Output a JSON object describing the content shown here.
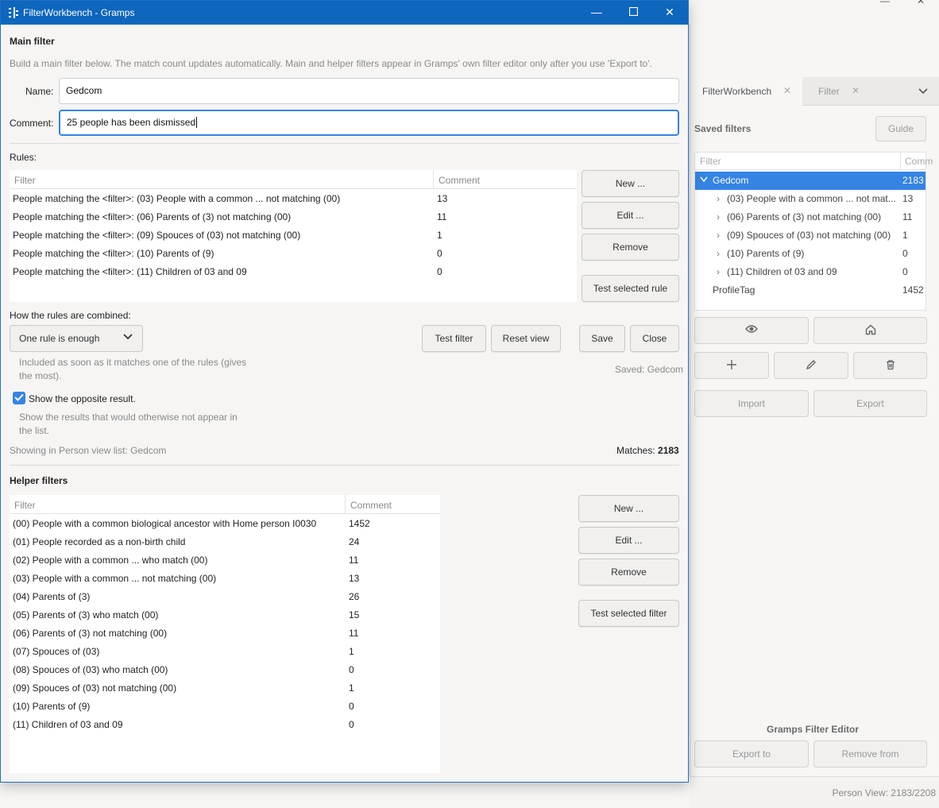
{
  "dialog": {
    "title": "FilterWorkbench - Gramps",
    "main_filter": {
      "heading": "Main filter",
      "description": "Build a main filter below. The match count updates automatically. Main and helper filters appear in Gramps' own filter editor only after you use 'Export to'.",
      "name_label": "Name:",
      "name_value": "Gedcom",
      "comment_label": "Comment:",
      "comment_value": "25 people has been dismissed",
      "rules_label": "Rules:",
      "rules_columns": [
        "Filter",
        "Comment"
      ],
      "rules": [
        {
          "filter": "People matching the <filter>: (03) People with a common ... not matching (00)",
          "comment": "13"
        },
        {
          "filter": "People matching the <filter>: (06) Parents of (3) not matching (00)",
          "comment": "11"
        },
        {
          "filter": "People matching the <filter>: (09) Spouces of (03) not matching (00)",
          "comment": "1"
        },
        {
          "filter": "People matching the <filter>: (10) Parents of (9)",
          "comment": "0"
        },
        {
          "filter": "People matching the <filter>: (11) Children of 03 and 09",
          "comment": "0"
        }
      ],
      "rule_buttons": {
        "new": "New ...",
        "edit": "Edit ...",
        "remove": "Remove",
        "test": "Test selected rule"
      },
      "combine_label": "How the rules are combined:",
      "combine_value": "One rule is enough",
      "combine_help": [
        "Included as soon as it matches one of the rules (gives",
        "the most)."
      ],
      "test_filter": "Test filter",
      "reset_view": "Reset view",
      "save": "Save",
      "close": "Close",
      "saved_status": "Saved: Gedcom",
      "opposite_label": "Show the opposite result.",
      "opposite_checked": true,
      "opposite_help": [
        "Show the results that would otherwise not appear in",
        "the list."
      ],
      "showing_text": "Showing in Person view list: Gedcom",
      "matches_label": "Matches:",
      "matches_value": "2183"
    },
    "helper_filters": {
      "heading": "Helper filters",
      "columns": [
        "Filter",
        "Comment"
      ],
      "rows": [
        {
          "filter": "(00) People with a common biological ancestor with Home person I0030",
          "comment": "1452"
        },
        {
          "filter": "(01) People recorded as a non-birth child",
          "comment": "24"
        },
        {
          "filter": "(02) People with a common ... who match (00)",
          "comment": "11"
        },
        {
          "filter": "(03) People with a common ... not matching (00)",
          "comment": "13"
        },
        {
          "filter": "(04) Parents of (3)",
          "comment": "26"
        },
        {
          "filter": "(05) Parents of (3) who match (00)",
          "comment": "15"
        },
        {
          "filter": "(06) Parents of (3) not matching (00)",
          "comment": "11"
        },
        {
          "filter": "(07) Spouces of (03)",
          "comment": "1"
        },
        {
          "filter": "(08) Spouces of (03) who match (00)",
          "comment": "0"
        },
        {
          "filter": "(09) Spouces of (03) not matching (00)",
          "comment": "1"
        },
        {
          "filter": "(10) Parents of (9)",
          "comment": "0"
        },
        {
          "filter": "(11) Children of 03 and 09",
          "comment": "0"
        }
      ],
      "buttons": {
        "new": "New ...",
        "edit": "Edit ...",
        "remove": "Remove",
        "test": "Test selected filter"
      }
    }
  },
  "sidebar": {
    "tabs": [
      {
        "label": "FilterWorkbench"
      },
      {
        "label": "Filter"
      }
    ],
    "saved_filters_label": "Saved filters",
    "guide_button": "Guide",
    "tree_columns": [
      "Filter",
      "Comm"
    ],
    "tree": [
      {
        "label": "Gedcom",
        "count": "2183",
        "selected": true,
        "expanded": true
      },
      {
        "label": "(03) People with a common ... not mat...",
        "count": "13"
      },
      {
        "label": "(06) Parents of (3) not matching (00)",
        "count": "11"
      },
      {
        "label": "(09) Spouces of (03) not matching (00)",
        "count": "1"
      },
      {
        "label": "(10) Parents of (9)",
        "count": "0"
      },
      {
        "label": "(11) Children of 03 and 09",
        "count": "0"
      },
      {
        "label": "ProfileTag",
        "count": "1452"
      }
    ],
    "import_button": "Import",
    "export_button": "Export",
    "editor_label": "Gramps Filter Editor",
    "export_to_button": "Export to",
    "remove_from_button": "Remove from"
  },
  "status": {
    "person_view": "Person View: 2183/2208"
  },
  "colors": {
    "titlebar": "#0e66bd",
    "selection": "#3584e4",
    "focus": "#3584e4"
  }
}
